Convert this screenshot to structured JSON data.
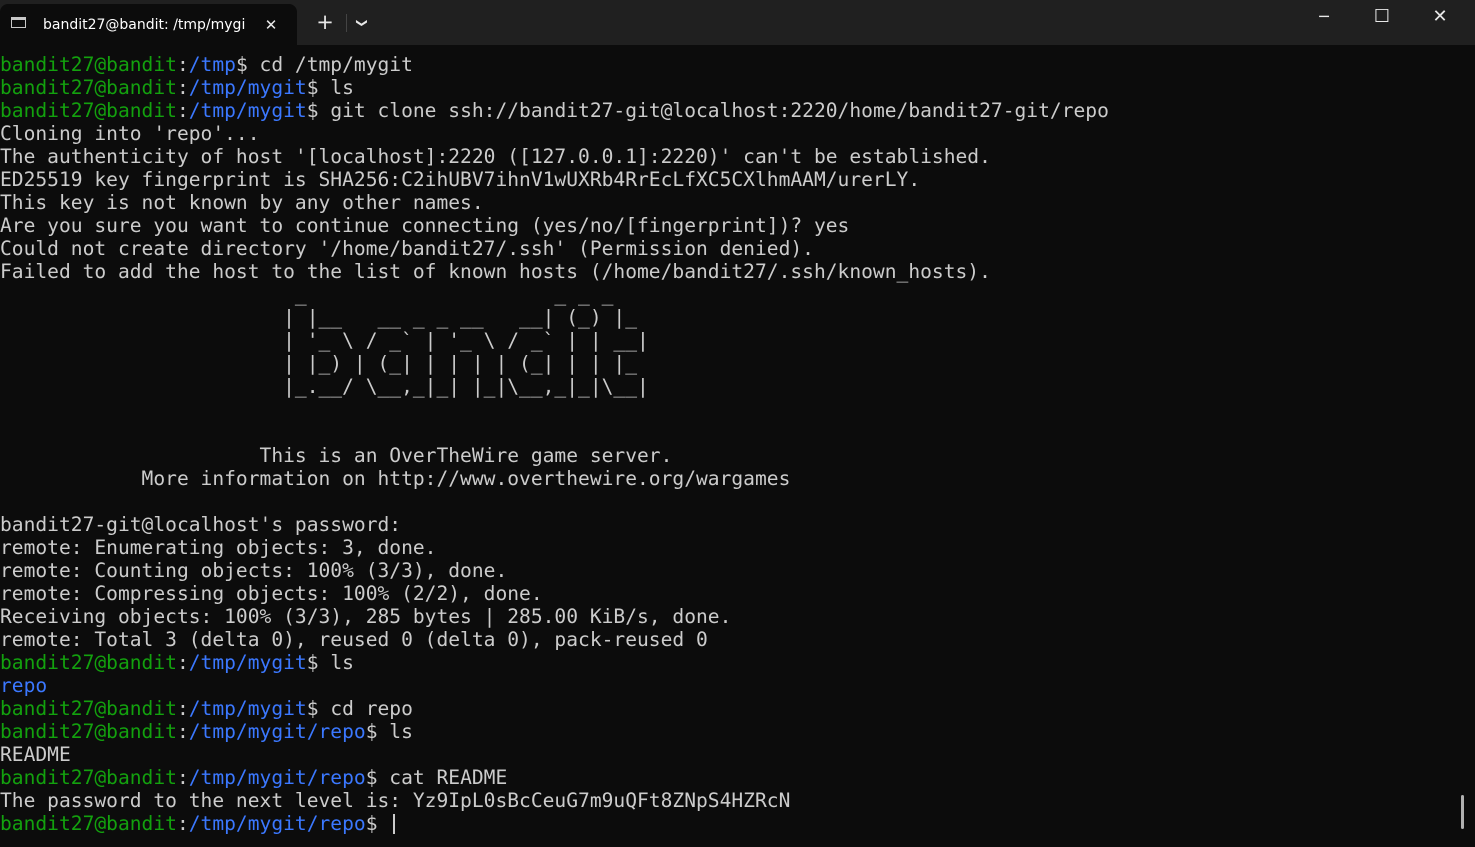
{
  "tab": {
    "title": "bandit27@bandit: /tmp/mygi",
    "icon": "terminal-icon",
    "close_glyph": "✕"
  },
  "titlebar": {
    "new_tab_glyph": "+",
    "dropdown_glyph": "❯",
    "minimize_glyph": "─",
    "maximize_glyph": "☐",
    "close_glyph": "✕"
  },
  "colors": {
    "background": "#0c0c0c",
    "text": "#cccccc",
    "user_host": "#13a10e",
    "path": "#3b78ff",
    "titlebar": "#202020"
  },
  "prompt": {
    "user": "bandit27@bandit",
    "separator": ":",
    "symbol": "$"
  },
  "terminal_lines": [
    {
      "t": "prompt",
      "path": "/tmp",
      "cmd": "cd /tmp/mygit"
    },
    {
      "t": "prompt",
      "path": "/tmp/mygit",
      "cmd": "ls"
    },
    {
      "t": "prompt",
      "path": "/tmp/mygit",
      "cmd": "git clone ssh://bandit27-git@localhost:2220/home/bandit27-git/repo"
    },
    {
      "t": "out",
      "text": "Cloning into 'repo'..."
    },
    {
      "t": "out",
      "text": "The authenticity of host '[localhost]:2220 ([127.0.0.1]:2220)' can't be established."
    },
    {
      "t": "out",
      "text": "ED25519 key fingerprint is SHA256:C2ihUBV7ihnV1wUXRb4RrEcLfXC5CXlhmAAM/urerLY."
    },
    {
      "t": "out",
      "text": "This key is not known by any other names."
    },
    {
      "t": "out",
      "text": "Are you sure you want to continue connecting (yes/no/[fingerprint])? yes"
    },
    {
      "t": "out",
      "text": "Could not create directory '/home/bandit27/.ssh' (Permission denied)."
    },
    {
      "t": "out",
      "text": "Failed to add the host to the list of known hosts (/home/bandit27/.ssh/known_hosts)."
    },
    {
      "t": "out",
      "text": "                         _                     _ _ _   "
    },
    {
      "t": "out",
      "text": "                        | |__   __ _ _ __   __| (_) |_ "
    },
    {
      "t": "out",
      "text": "                        | '_ \\ / _` | '_ \\ / _` | | __|"
    },
    {
      "t": "out",
      "text": "                        | |_) | (_| | | | | (_| | | |_ "
    },
    {
      "t": "out",
      "text": "                        |_.__/ \\__,_|_| |_|\\__,_|_|\\__|"
    },
    {
      "t": "out",
      "text": ""
    },
    {
      "t": "out",
      "text": ""
    },
    {
      "t": "out",
      "text": "                      This is an OverTheWire game server."
    },
    {
      "t": "out",
      "text": "            More information on http://www.overthewire.org/wargames"
    },
    {
      "t": "out",
      "text": ""
    },
    {
      "t": "out",
      "text": "bandit27-git@localhost's password:"
    },
    {
      "t": "out",
      "text": "remote: Enumerating objects: 3, done."
    },
    {
      "t": "out",
      "text": "remote: Counting objects: 100% (3/3), done."
    },
    {
      "t": "out",
      "text": "remote: Compressing objects: 100% (2/2), done."
    },
    {
      "t": "out",
      "text": "Receiving objects: 100% (3/3), 285 bytes | 285.00 KiB/s, done."
    },
    {
      "t": "out",
      "text": "remote: Total 3 (delta 0), reused 0 (delta 0), pack-reused 0"
    },
    {
      "t": "prompt",
      "path": "/tmp/mygit",
      "cmd": "ls"
    },
    {
      "t": "dir",
      "text": "repo"
    },
    {
      "t": "prompt",
      "path": "/tmp/mygit",
      "cmd": "cd repo"
    },
    {
      "t": "prompt",
      "path": "/tmp/mygit/repo",
      "cmd": "ls"
    },
    {
      "t": "out",
      "text": "README"
    },
    {
      "t": "prompt",
      "path": "/tmp/mygit/repo",
      "cmd": "cat README"
    },
    {
      "t": "out",
      "text": "The password to the next level is: Yz9IpL0sBcCeuG7m9uQFt8ZNpS4HZRcN"
    },
    {
      "t": "prompt",
      "path": "/tmp/mygit/repo",
      "cmd": "",
      "cursor": true
    }
  ]
}
